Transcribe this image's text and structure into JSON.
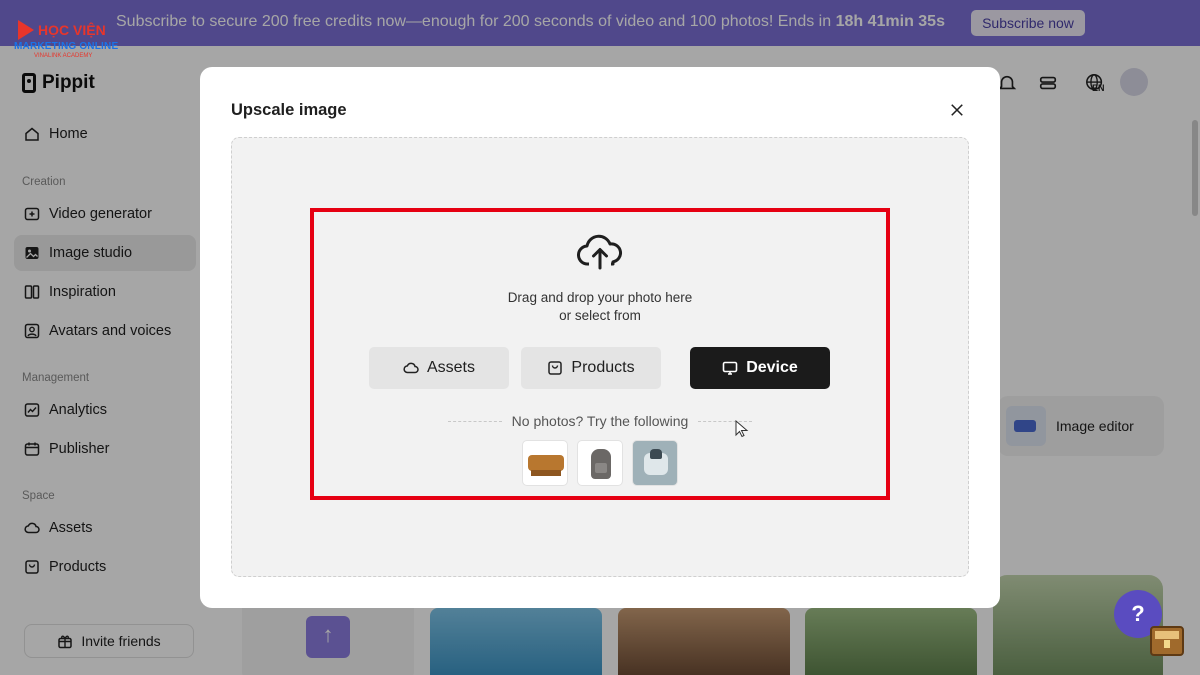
{
  "banner": {
    "message": "Subscribe to secure 200 free credits now—enough for 200 seconds of video and 100 photos! Ends in ",
    "countdown": "18h 41min 35s",
    "cta_label": "Subscribe now"
  },
  "watermark": {
    "line1": "HỌC VIỆN",
    "line2": "MARKETING ONLINE",
    "line3": "VINALINK ACADEMY"
  },
  "sidebar": {
    "brand": "Pippit",
    "home": "Home",
    "sections": {
      "creation": "Creation",
      "management": "Management",
      "space": "Space"
    },
    "creation_items": [
      "Video generator",
      "Image studio",
      "Inspiration",
      "Avatars and voices"
    ],
    "management_items": [
      "Analytics",
      "Publisher"
    ],
    "space_items": [
      "Assets",
      "Products"
    ],
    "invite_label": "Invite friends",
    "active_item": "Image studio"
  },
  "header": {
    "language": "EN"
  },
  "background": {
    "image_editor_label": "Image editor"
  },
  "modal": {
    "title": "Upscale image",
    "drop_line1": "Drag and drop your photo here",
    "drop_line2": "or select from",
    "buttons": {
      "assets": "Assets",
      "products": "Products",
      "device": "Device"
    },
    "try_text": "No photos? Try the following",
    "samples": [
      "sofa",
      "backpack",
      "earbuds"
    ]
  },
  "colors": {
    "banner_bg": "#7b6fd6",
    "highlight": "#e60012",
    "device_button": "#1b1b1b",
    "help_button": "#5a4cc0"
  }
}
